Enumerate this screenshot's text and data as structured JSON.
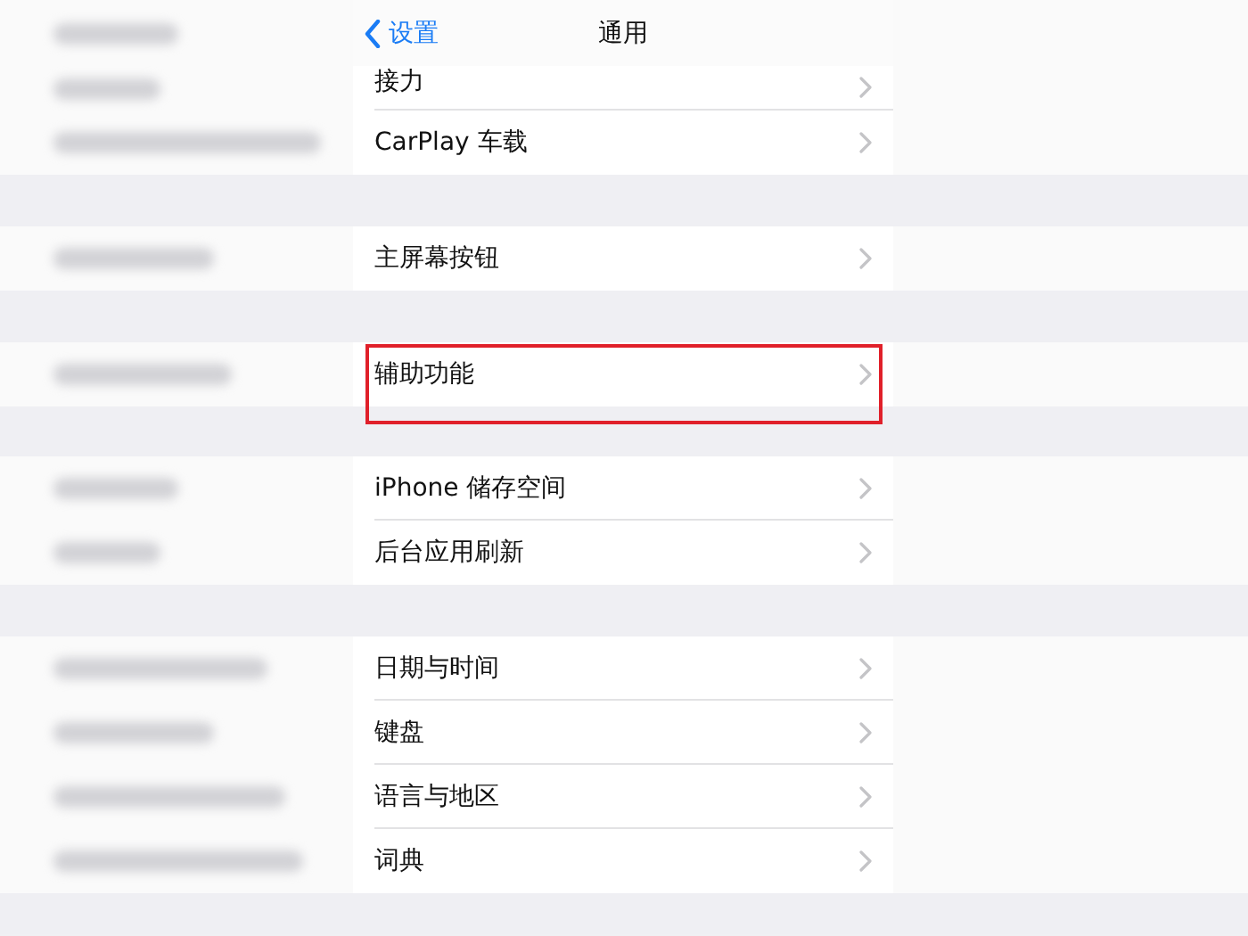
{
  "nav": {
    "back": "设置",
    "title": "通用"
  },
  "groups": [
    {
      "rows": [
        {
          "label": "接力",
          "highlighted": false
        },
        {
          "label": "CarPlay 车载",
          "highlighted": false
        }
      ]
    },
    {
      "rows": [
        {
          "label": "主屏幕按钮",
          "highlighted": false
        }
      ]
    },
    {
      "rows": [
        {
          "label": "辅助功能",
          "highlighted": true
        }
      ]
    },
    {
      "rows": [
        {
          "label": "iPhone 储存空间",
          "highlighted": false
        },
        {
          "label": "后台应用刷新",
          "highlighted": false
        }
      ]
    },
    {
      "rows": [
        {
          "label": "日期与时间",
          "highlighted": false
        },
        {
          "label": "键盘",
          "highlighted": false
        },
        {
          "label": "语言与地区",
          "highlighted": false
        },
        {
          "label": "词典",
          "highlighted": false
        }
      ]
    }
  ]
}
